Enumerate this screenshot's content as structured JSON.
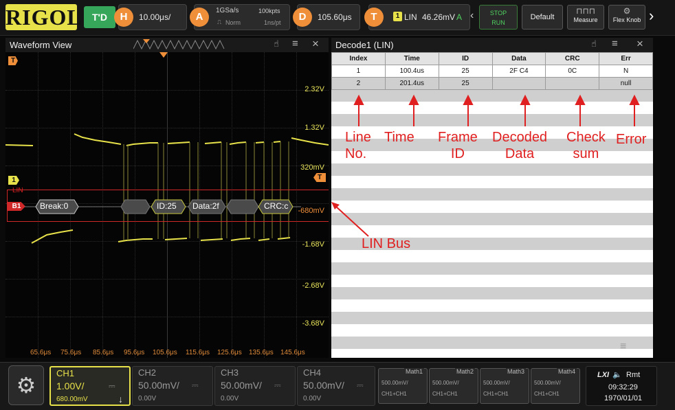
{
  "topbar": {
    "logo": "RIGOL",
    "td": "T'D",
    "horizontal": {
      "letter": "H",
      "value": "10.00μs/"
    },
    "acquire": {
      "letter": "A",
      "rate": "1GSa/s",
      "mode": "Norm",
      "depth": "100kpts",
      "interval": "1ns/pt"
    },
    "delay": {
      "letter": "D",
      "value": "105.60μs"
    },
    "trigger": {
      "letter": "T",
      "source": "1",
      "type": "LIN",
      "level": "46.26mV",
      "status": "A"
    },
    "stop_run_top": "STOP",
    "stop_run_bottom": "RUN",
    "default_label": "Default",
    "measure_label": "Measure",
    "flexknob_label": "Flex Knob"
  },
  "waveform": {
    "title": "Waveform View",
    "volt_labels": [
      "2.32V",
      "1.32V",
      "320mV",
      "-680mV",
      "-1.68V",
      "-2.68V",
      "-3.68V"
    ],
    "time_labels": [
      "65.6μs",
      "75.6μs",
      "85.6μs",
      "95.6μs",
      "105.6μs",
      "115.6μs",
      "125.6μs",
      "135.6μs",
      "145.6μs"
    ],
    "trigger_marker": "T",
    "ch1_marker": "1",
    "lin_label": "LIN",
    "bus_marker": "B1",
    "bus_segments": [
      "Break:0",
      "ID:25",
      "Data:2f",
      "CRC:c"
    ]
  },
  "decode": {
    "title": "Decode1 (LIN)",
    "columns": [
      "Index",
      "Time",
      "ID",
      "Data",
      "CRC",
      "Err"
    ],
    "rows": [
      [
        "1",
        "100.4us",
        "25",
        "2F C4",
        "0C",
        "N"
      ],
      [
        "2",
        "201.4us",
        "25",
        "",
        "",
        "null"
      ]
    ]
  },
  "annotations": {
    "line_no": [
      "Line",
      "No."
    ],
    "time": "Time",
    "frame_id": [
      "Frame",
      "ID"
    ],
    "decoded_data": [
      "Decoded",
      "Data"
    ],
    "check_sum": [
      "Check",
      "sum"
    ],
    "error": "Error",
    "lin_bus": "LIN Bus"
  },
  "channels": [
    {
      "name": "CH1",
      "scale": "1.00V/",
      "offset": "680.00mV",
      "color": "#e8e24a"
    },
    {
      "name": "CH2",
      "scale": "50.00mV/",
      "offset": "0.00V",
      "color": "#777777"
    },
    {
      "name": "CH3",
      "scale": "50.00mV/",
      "offset": "0.00V",
      "color": "#777777"
    },
    {
      "name": "CH4",
      "scale": "50.00mV/",
      "offset": "0.00V",
      "color": "#777777"
    }
  ],
  "math": [
    {
      "name": "Math1",
      "scale": "500.00mV/",
      "expr": "CH1+CH1"
    },
    {
      "name": "Math2",
      "scale": "500.00mV/",
      "expr": "CH1+CH1"
    },
    {
      "name": "Math3",
      "scale": "500.00mV/",
      "expr": "CH1+CH1"
    },
    {
      "name": "Math4",
      "scale": "500.00mV/",
      "expr": "CH1+CH1"
    }
  ],
  "status": {
    "lxi": "LXI",
    "rmt": "Rmt",
    "time": "09:32:29",
    "date": "1970/01/01"
  },
  "colors": {
    "accent": "#e8e24a",
    "trigger": "#f08f3a",
    "annotation": "#e02020",
    "bus": "#d02828"
  }
}
